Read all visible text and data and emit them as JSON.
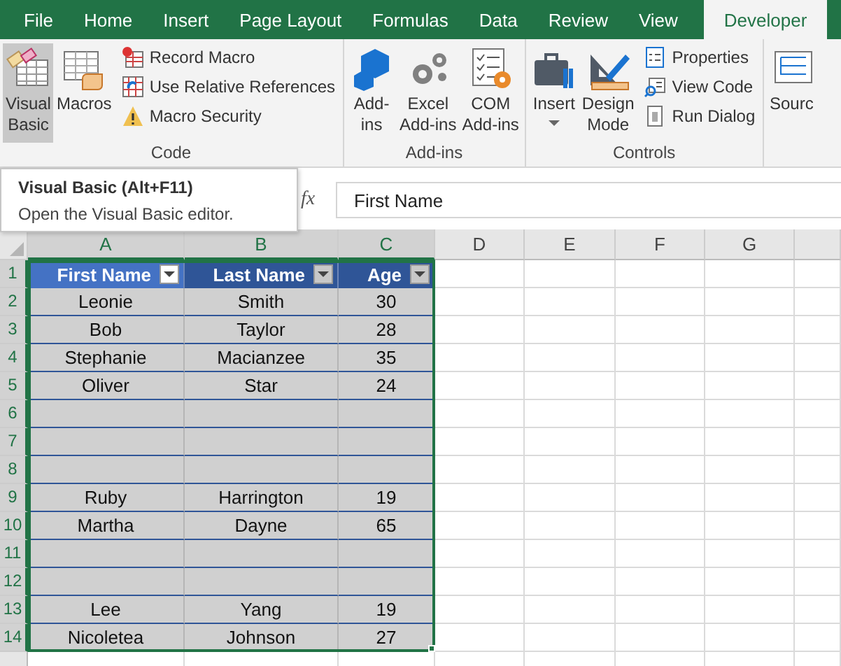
{
  "tabs": [
    {
      "label": "File",
      "selected": false
    },
    {
      "label": "Home",
      "selected": false
    },
    {
      "label": "Insert",
      "selected": false
    },
    {
      "label": "Page Layout",
      "selected": false
    },
    {
      "label": "Formulas",
      "selected": false
    },
    {
      "label": "Data",
      "selected": false
    },
    {
      "label": "Review",
      "selected": false
    },
    {
      "label": "View",
      "selected": false
    },
    {
      "label": "Developer",
      "selected": true
    }
  ],
  "ribbon": {
    "groups": [
      {
        "label": "Code",
        "large": [
          {
            "lines": [
              "Visual",
              "Basic"
            ],
            "hovered": true,
            "dropdown": false
          },
          {
            "lines": [
              "Macros"
            ],
            "hovered": false,
            "dropdown": false
          }
        ],
        "small": [
          "Record Macro",
          "Use Relative References",
          "Macro Security"
        ]
      },
      {
        "label": "Add-ins",
        "large": [
          {
            "lines": [
              "Add-",
              "ins"
            ],
            "hovered": false,
            "dropdown": false
          },
          {
            "lines": [
              "Excel",
              "Add-ins"
            ],
            "hovered": false,
            "dropdown": false
          },
          {
            "lines": [
              "COM",
              "Add-ins"
            ],
            "hovered": false,
            "dropdown": false
          }
        ]
      },
      {
        "label": "Controls",
        "large": [
          {
            "lines": [
              "Insert"
            ],
            "hovered": false,
            "dropdown": true
          },
          {
            "lines": [
              "Design",
              "Mode"
            ],
            "hovered": false,
            "dropdown": false
          }
        ],
        "small": [
          "Properties",
          "View Code",
          "Run Dialog"
        ]
      }
    ],
    "cut_off_button": "Sourc"
  },
  "tooltip": {
    "title": "Visual Basic (Alt+F11)",
    "text": "Open the Visual Basic editor."
  },
  "formula_bar": {
    "function_label": "fx",
    "value": "First Name"
  },
  "column_headers": [
    {
      "label": "A",
      "selected": true
    },
    {
      "label": "B",
      "selected": true
    },
    {
      "label": "C",
      "selected": true
    },
    {
      "label": "D",
      "selected": false
    },
    {
      "label": "E",
      "selected": false
    },
    {
      "label": "F",
      "selected": false
    },
    {
      "label": "G",
      "selected": false
    }
  ],
  "row_headers": [
    {
      "label": "1",
      "selected": true
    },
    {
      "label": "2",
      "selected": true
    },
    {
      "label": "3",
      "selected": true
    },
    {
      "label": "4",
      "selected": true
    },
    {
      "label": "5",
      "selected": true
    },
    {
      "label": "6",
      "selected": true
    },
    {
      "label": "7",
      "selected": true
    },
    {
      "label": "8",
      "selected": true
    },
    {
      "label": "9",
      "selected": true
    },
    {
      "label": "10",
      "selected": true
    },
    {
      "label": "11",
      "selected": true
    },
    {
      "label": "12",
      "selected": true
    },
    {
      "label": "13",
      "selected": true
    },
    {
      "label": "14",
      "selected": true
    }
  ],
  "table": {
    "columns": [
      {
        "label": "First Name",
        "active": true
      },
      {
        "label": "Last Name",
        "active": false
      },
      {
        "label": "Age",
        "active": false
      }
    ],
    "rows": [
      {
        "kind": "data",
        "cells": [
          "Leonie",
          "Smith",
          "30"
        ]
      },
      {
        "kind": "data",
        "cells": [
          "Bob",
          "Taylor",
          "28"
        ]
      },
      {
        "kind": "data",
        "cells": [
          "Stephanie",
          "Macianzee",
          "35"
        ]
      },
      {
        "kind": "data",
        "cells": [
          "Oliver",
          "Star",
          "24"
        ]
      },
      {
        "kind": "blank"
      },
      {
        "kind": "blank"
      },
      {
        "kind": "blank"
      },
      {
        "kind": "data",
        "cells": [
          "Ruby",
          "Harrington",
          "19"
        ]
      },
      {
        "kind": "data",
        "cells": [
          "Martha",
          "Dayne",
          "65"
        ]
      },
      {
        "kind": "blank"
      },
      {
        "kind": "blank"
      },
      {
        "kind": "data",
        "cells": [
          "Lee",
          "Yang",
          "19"
        ]
      },
      {
        "kind": "data",
        "cells": [
          "Nicoletea",
          "Johnson",
          "27"
        ]
      }
    ]
  }
}
